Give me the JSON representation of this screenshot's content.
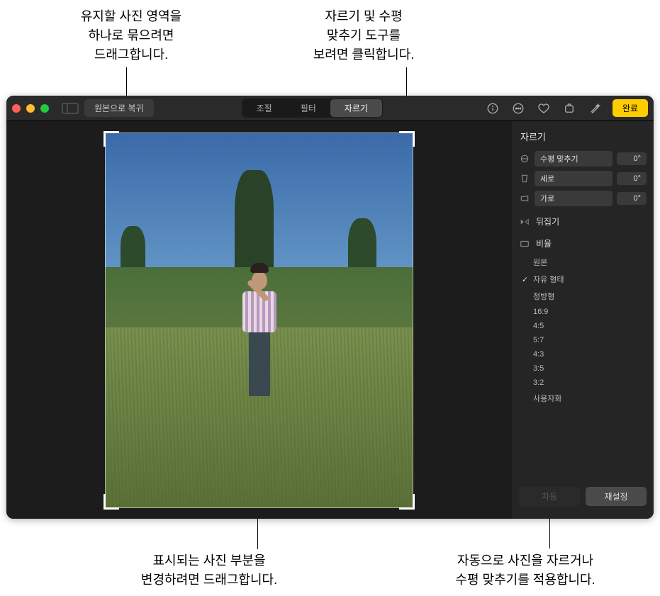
{
  "callouts": {
    "top_left": "유지할 사진 영역을\n하나로 묶으려면\n드래그합니다.",
    "top_right": "자르기 및 수평\n맞추기 도구를\n보려면 클릭합니다.",
    "bottom_left": "표시되는 사진 부분을\n변경하려면 드래그합니다.",
    "bottom_right": "자동으로 사진을 자르거나\n수평 맞추기를 적용합니다."
  },
  "toolbar": {
    "revert_label": "원본으로 복귀",
    "segments": {
      "adjust": "조절",
      "filters": "필터",
      "crop": "자르기"
    },
    "done_label": "완료"
  },
  "sidebar": {
    "title": "자르기",
    "sliders": {
      "straighten": {
        "label": "수평 맞추기",
        "value": "0°"
      },
      "vertical": {
        "label": "세로",
        "value": "0°"
      },
      "horizontal": {
        "label": "가로",
        "value": "0°"
      }
    },
    "flip_label": "뒤집기",
    "aspect_label": "비율",
    "ratios": {
      "original": "원본",
      "freeform": "자유 형태",
      "square": "정방형",
      "r169": "16:9",
      "r45": "4:5",
      "r57": "5:7",
      "r43": "4:3",
      "r35": "3:5",
      "r32": "3:2",
      "custom": "사용자화"
    },
    "footer": {
      "auto": "자동",
      "reset": "재설정"
    }
  }
}
